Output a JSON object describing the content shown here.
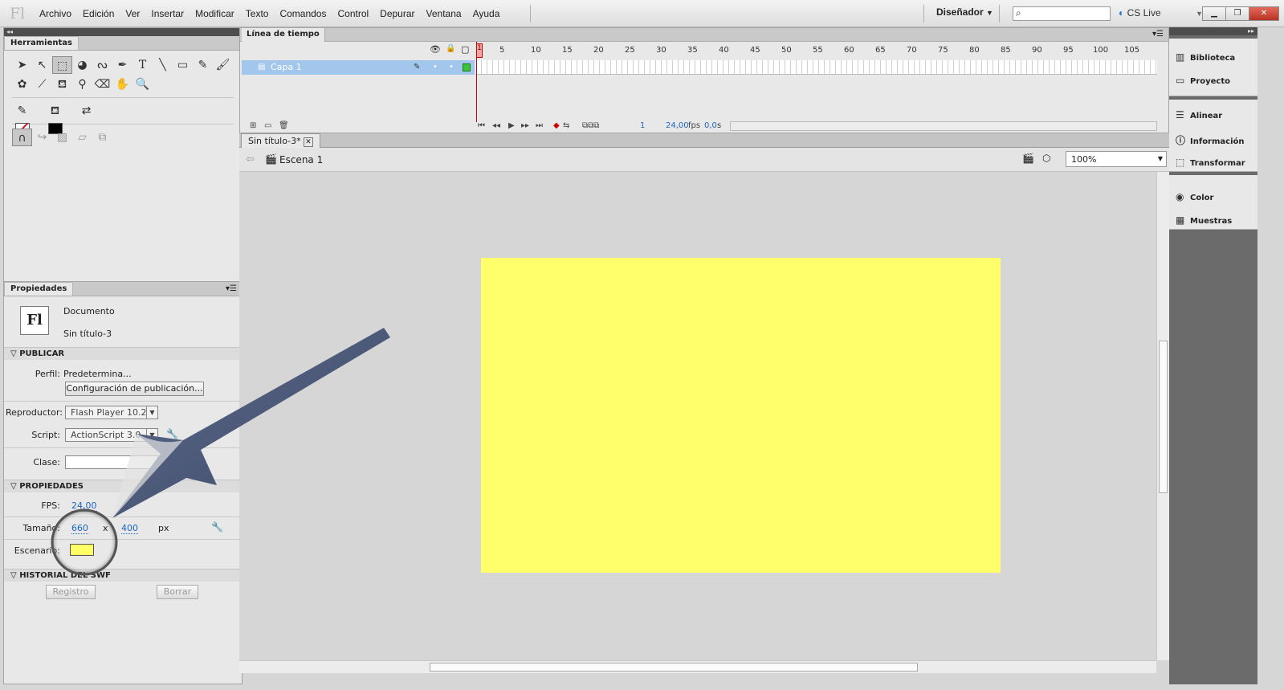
{
  "app": {
    "logo": "Fl",
    "menu": [
      "Archivo",
      "Edición",
      "Ver",
      "Insertar",
      "Modificar",
      "Texto",
      "Comandos",
      "Control",
      "Depurar",
      "Ventana",
      "Ayuda"
    ],
    "workspace": "Diseñador",
    "cslive": "CS Live"
  },
  "tools": {
    "tab": "Herramientas"
  },
  "timeline": {
    "tab": "Línea de tiempo",
    "layer": "Capa 1",
    "ruler": [
      "1",
      "5",
      "10",
      "15",
      "20",
      "25",
      "30",
      "35",
      "40",
      "45",
      "50",
      "55",
      "60",
      "65",
      "70",
      "75",
      "80",
      "85",
      "90",
      "95",
      "100",
      "105"
    ],
    "current_frame": "1",
    "fps": "24,00",
    "fps_unit": "fps",
    "time": "0,0",
    "time_unit": "s"
  },
  "document": {
    "tab": "Sin título-3*",
    "scene": "Escena 1",
    "zoom": "100%"
  },
  "properties": {
    "tab": "Propiedades",
    "doc_type": "Documento",
    "doc_name": "Sin título-3",
    "publish_section": "PUBLICAR",
    "profile_label": "Perfil:",
    "profile_value": "Predetermina...",
    "publish_settings_button": "Configuración de publicación...",
    "player_label": "Reproductor:",
    "player_value": "Flash Player 10.2",
    "script_label": "Script:",
    "script_value": "ActionScript 3.0",
    "class_label": "Clase:",
    "props_section": "PROPIEDADES",
    "fps_label": "FPS:",
    "fps_value": "24,00",
    "size_label": "Tamaño:",
    "width": "660",
    "times": "x",
    "height": "400",
    "unit": "px",
    "stage_label": "Escenario:",
    "stage_color": "#ffff66",
    "history_section": "HISTORIAL DEL SWF",
    "log_button": "Registro",
    "clear_button": "Borrar"
  },
  "right_panel": [
    {
      "label": "Biblioteca",
      "icon": "library-icon"
    },
    {
      "label": "Proyecto",
      "icon": "project-icon"
    },
    {
      "label": "Alinear",
      "icon": "align-icon"
    },
    {
      "label": "Información",
      "icon": "info-icon"
    },
    {
      "label": "Transformar",
      "icon": "transform-icon"
    },
    {
      "label": "Color",
      "icon": "color-icon"
    },
    {
      "label": "Muestras",
      "icon": "swatches-icon"
    }
  ],
  "colors": {
    "stage": "#ffff6c",
    "layer_selected": "#a3c7ec",
    "arrow": "#4b5a7a"
  }
}
